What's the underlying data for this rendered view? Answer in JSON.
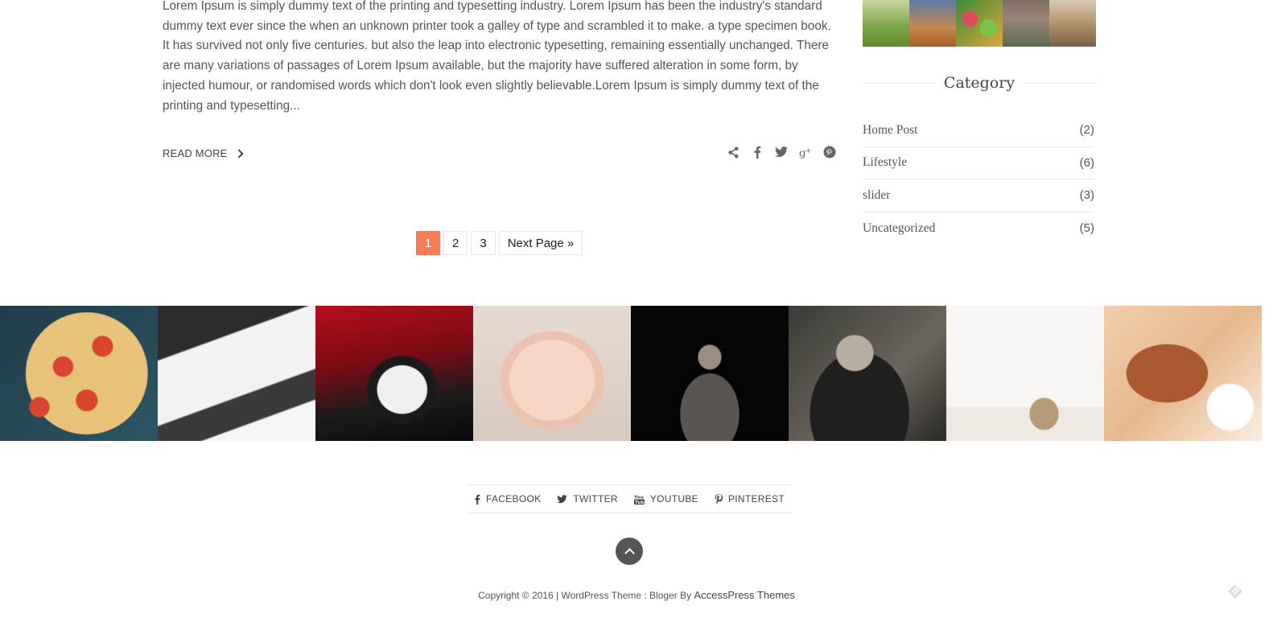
{
  "post": {
    "excerpt": "Lorem Ipsum is simply dummy text of the printing and typesetting industry. Lorem Ipsum has been the industry's standard dummy text ever since the when an unknown printer took a galley of type and scrambled it to make. a type specimen book. It has survived not only five centuries. but also the leap into electronic typesetting, remaining essentially unchanged. There are many variations of passages of Lorem Ipsum available, but the majority have suffered alteration in some form, by injected humour, or randomised words which don't look even slightly believable.Lorem Ipsum is simply dummy text of the printing and typesetting...",
    "read_more_label": "READ MORE",
    "share_icons": [
      "share-icon",
      "facebook-icon",
      "twitter-icon",
      "google-plus-icon",
      "pinterest-icon"
    ]
  },
  "pagination": {
    "pages": [
      "1",
      "2",
      "3"
    ],
    "current": "1",
    "next_label": "Next Page »"
  },
  "sidebar": {
    "category_title": "Category",
    "categories": [
      {
        "name": "Home Post",
        "count": "(2)"
      },
      {
        "name": "Lifestyle",
        "count": "(6)"
      },
      {
        "name": "slider",
        "count": "(3)"
      },
      {
        "name": "Uncategorized",
        "count": "(5)"
      }
    ]
  },
  "footer": {
    "social": [
      {
        "label": "FACEBOOK",
        "icon": "facebook-icon"
      },
      {
        "label": "TWITTER",
        "icon": "twitter-icon"
      },
      {
        "label": "YOUTUBE",
        "icon": "youtube-icon"
      },
      {
        "label": "PINTEREST",
        "icon": "pinterest-icon"
      }
    ],
    "copyright_text": "Copyright © 2016 | WordPress Theme : Bloger By",
    "brand": "AccessPress Themes"
  },
  "colors": {
    "accent": "#f87c56",
    "text": "#555555"
  }
}
